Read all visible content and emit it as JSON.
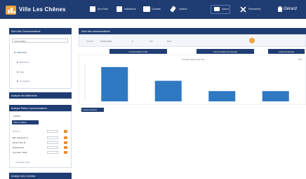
{
  "app": {
    "title": "Ville Les Chênes",
    "user": "Gérard"
  },
  "nav": [
    {
      "label": "Mon Suivi",
      "icon": "home-icon"
    },
    {
      "label": "Indicateurs",
      "icon": "chart-icon"
    },
    {
      "label": "Contrats",
      "icon": "document-icon"
    },
    {
      "label": "Gestion",
      "icon": "edit-icon"
    },
    {
      "label": "Admin",
      "icon": "monitor-icon"
    },
    {
      "label": "Paramètres",
      "icon": "tools-icon"
    }
  ],
  "sidebar": {
    "panel1": {
      "title": "Suivi des Consommations",
      "select_value": "Année 2014",
      "tree": [
        "Patrimoine",
        "Bâtiments",
        "Sites",
        "Compteurs"
      ]
    },
    "panel2": {
      "title": "Analyse des Bâtiments"
    },
    "panel3": {
      "title": "Analyse Ratios Consommations",
      "sub_label": "Surface",
      "tab_label": "Filtre en Ratios",
      "rows": [
        "Bâtiment",
        "Bât. Ville Ecole, A.",
        "Ecoles Ville, B.",
        "Equipements",
        "Gymnase / Salle"
      ],
      "footer": "Comparer avec"
    },
    "panel4": {
      "title": "Analyse des Contrats"
    }
  },
  "main": {
    "title": "Suivi des consommations",
    "filters": [
      {
        "label": "Période",
        "value": "Année 2014"
      },
      {
        "label": "Site",
        "value": "Tous"
      }
    ],
    "tabs": [
      "Consommation Totale",
      "Consommation par Energie",
      "Coûts par Energie"
    ],
    "chart_title": "Consommations par site",
    "legend_text": "kWh",
    "footer_badge": "Consommations"
  },
  "chart_data": {
    "type": "bar",
    "title": "Consommations par site",
    "xlabel": "",
    "ylabel": "",
    "categories": [
      "",
      "",
      "",
      ""
    ],
    "values": [
      100,
      60,
      30,
      30
    ],
    "ylim": [
      0,
      110
    ],
    "bar_color": "#2e79c2"
  }
}
